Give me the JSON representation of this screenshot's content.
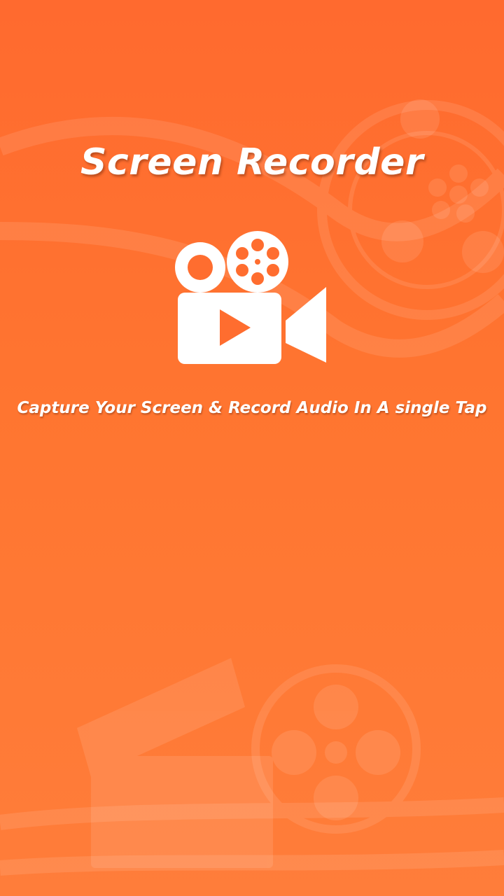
{
  "app": {
    "title": "Screen Recorder",
    "tagline": "Capture Your Screen & Record Audio In A single Tap"
  },
  "icons": {
    "logo": "video-camera-play-icon",
    "background": "film-reel-and-clapperboard-pattern"
  },
  "colors": {
    "background_top": "#ff6a2f",
    "background_bottom": "#ff7d3a",
    "foreground": "#ffffff"
  }
}
